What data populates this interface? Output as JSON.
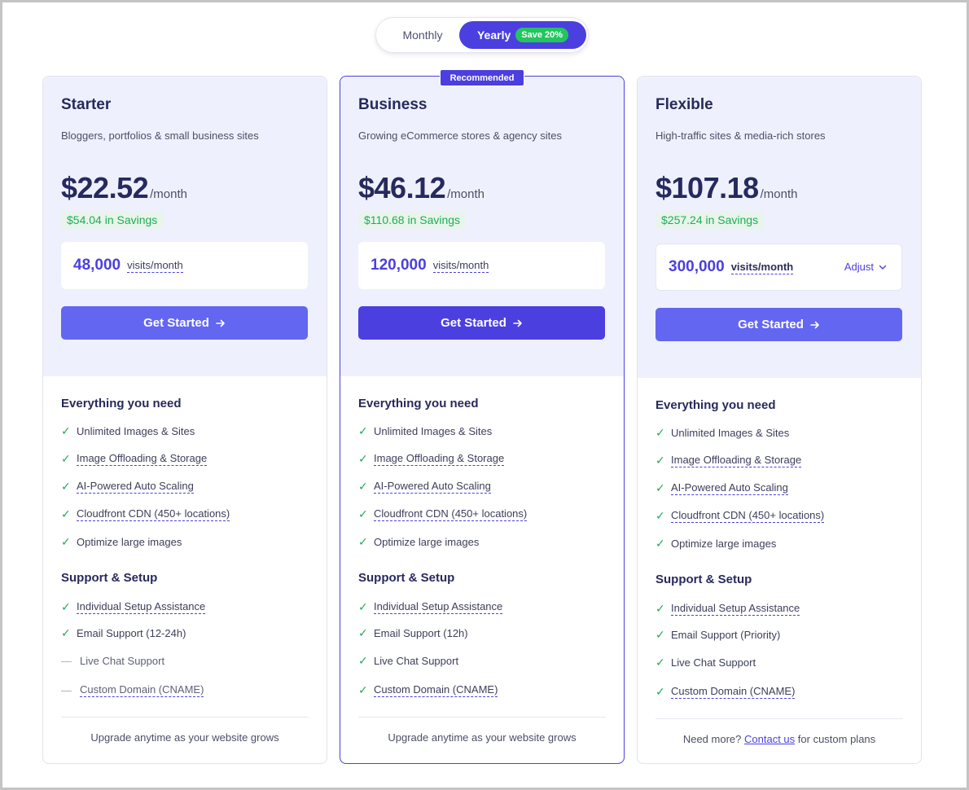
{
  "billing_toggle": {
    "monthly_label": "Monthly",
    "yearly_label": "Yearly",
    "save_badge": "Save 20%",
    "selected": "Yearly"
  },
  "plans": [
    {
      "name": "Starter",
      "description": "Bloggers, portfolios & small business sites",
      "price": "$22.52",
      "period": "/month",
      "savings": "$54.04 in Savings",
      "visits": "48,000",
      "visits_unit": "visits/month",
      "cta": "Get Started",
      "everything_title": "Everything you need",
      "features": [
        {
          "label": "Unlimited Images & Sites",
          "included": true
        },
        {
          "label": "Image Offloading & Storage",
          "included": true
        },
        {
          "label": "AI-Powered Auto Scaling",
          "included": true
        },
        {
          "label": "Cloudfront CDN (450+ locations)",
          "included": true
        },
        {
          "label": "Optimize large images",
          "included": true
        }
      ],
      "support_title": "Support & Setup",
      "support": [
        {
          "label": "Individual Setup Assistance",
          "included": true
        },
        {
          "label": "Email Support (12-24h)",
          "included": true
        },
        {
          "label": "Live Chat Support",
          "included": false
        },
        {
          "label": "Custom Domain (CNAME)",
          "included": false
        }
      ],
      "footer": "Upgrade anytime as your website grows"
    },
    {
      "name": "Business",
      "badge": "Recommended",
      "description": "Growing eCommerce stores & agency sites",
      "price": "$46.12",
      "period": "/month",
      "savings": "$110.68 in Savings",
      "visits": "120,000",
      "visits_unit": "visits/month",
      "cta": "Get Started",
      "everything_title": "Everything you need",
      "features": [
        {
          "label": "Unlimited Images & Sites",
          "included": true
        },
        {
          "label": "Image Offloading & Storage",
          "included": true
        },
        {
          "label": "AI-Powered Auto Scaling",
          "included": true
        },
        {
          "label": "Cloudfront CDN (450+ locations)",
          "included": true
        },
        {
          "label": "Optimize large images",
          "included": true
        }
      ],
      "support_title": "Support & Setup",
      "support": [
        {
          "label": "Individual Setup Assistance",
          "included": true
        },
        {
          "label": "Email Support (12h)",
          "included": true
        },
        {
          "label": "Live Chat Support",
          "included": true
        },
        {
          "label": "Custom Domain (CNAME)",
          "included": true
        }
      ],
      "footer": "Upgrade anytime as your website grows"
    },
    {
      "name": "Flexible",
      "description": "High-traffic sites & media-rich stores",
      "price": "$107.18",
      "period": "/month",
      "savings": "$257.24 in Savings",
      "visits": "300,000",
      "visits_unit": "visits/month",
      "adjust_label": "Adjust",
      "cta": "Get Started",
      "everything_title": "Everything you need",
      "features": [
        {
          "label": "Unlimited Images & Sites",
          "included": true
        },
        {
          "label": "Image Offloading & Storage",
          "included": true
        },
        {
          "label": "AI-Powered Auto Scaling",
          "included": true
        },
        {
          "label": "Cloudfront CDN (450+ locations)",
          "included": true
        },
        {
          "label": "Optimize large images",
          "included": true
        }
      ],
      "support_title": "Support & Setup",
      "support": [
        {
          "label": "Individual Setup Assistance",
          "included": true
        },
        {
          "label": "Email Support (Priority)",
          "included": true
        },
        {
          "label": "Live Chat Support",
          "included": true
        },
        {
          "label": "Custom Domain (CNAME)",
          "included": true
        }
      ],
      "footer_prefix": "Need more?",
      "footer_link": "Contact us",
      "footer_suffix": "for custom plans"
    }
  ],
  "icons": {
    "check": "check-icon",
    "dash": "dash-icon",
    "arrow": "arrow-right-icon",
    "chevron": "chevron-down-icon"
  },
  "colors": {
    "accent": "#4b3fe0",
    "button": "#6366f1",
    "savings_green": "#1fae55",
    "check_green": "#22a85a",
    "card_top_bg": "#eef1fd"
  }
}
